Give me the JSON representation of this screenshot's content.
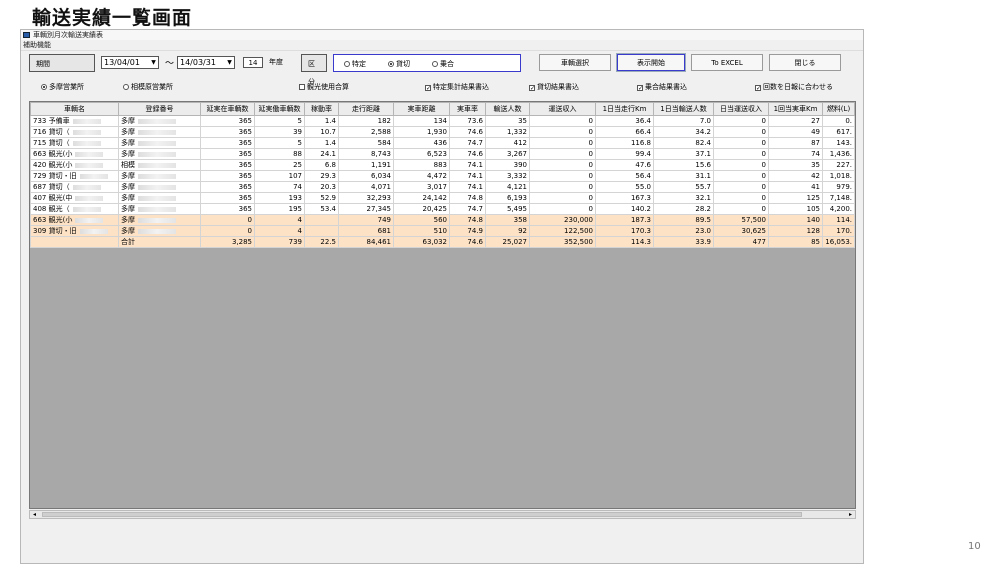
{
  "slide": {
    "title": "輸送実績一覧画面",
    "page_number": "10"
  },
  "window": {
    "title": "車輌別月次輸送実績表",
    "menu": "補助機能"
  },
  "filters": {
    "period_label": "期間",
    "from_date": "13/04/01",
    "wave": "〜",
    "to_date": "14/03/31",
    "year_value": "14",
    "year_label": "年度",
    "class_label": "区分",
    "radios": [
      "特定",
      "貸切",
      "乗合"
    ],
    "selected_radio": "貸切",
    "buttons": {
      "vehicle_select": "車輌選択",
      "start_display": "表示開始",
      "excel": "To EXCEL",
      "close": "閉じる"
    }
  },
  "options": {
    "office_radios": [
      "多摩営業所",
      "相模原営業所"
    ],
    "selected_office": "多摩営業所",
    "checkboxes": [
      {
        "label": "観光使用合算",
        "checked": false
      },
      {
        "label": "特定集計結果書込",
        "checked": true
      },
      {
        "label": "貸切結果書込",
        "checked": true
      },
      {
        "label": "乗合結果書込",
        "checked": true
      },
      {
        "label": "回数を日報に合わせる",
        "checked": true
      }
    ]
  },
  "table": {
    "headers": [
      "車輌名",
      "登録番号",
      "延実在車輌数",
      "延実働車輌数",
      "稼動率",
      "走行距離",
      "実車距離",
      "実車率",
      "輸送人数",
      "運送収入",
      "1日当走行Km",
      "1日当輸送人数",
      "日当運送収入",
      "1回当実車Km",
      "燃料(L)"
    ],
    "rows": [
      {
        "cells": [
          "733 予備車",
          "多摩",
          "365",
          "5",
          "1.4",
          "182",
          "134",
          "73.6",
          "35",
          "0",
          "36.4",
          "7.0",
          "0",
          "27",
          "0."
        ],
        "hl": false
      },
      {
        "cells": [
          "716 貸切（",
          "多摩",
          "365",
          "39",
          "10.7",
          "2,588",
          "1,930",
          "74.6",
          "1,332",
          "0",
          "66.4",
          "34.2",
          "0",
          "49",
          "617."
        ],
        "hl": false
      },
      {
        "cells": [
          "715 貸切（",
          "多摩",
          "365",
          "5",
          "1.4",
          "584",
          "436",
          "74.7",
          "412",
          "0",
          "116.8",
          "82.4",
          "0",
          "87",
          "143."
        ],
        "hl": false
      },
      {
        "cells": [
          "663 観光(小",
          "多摩",
          "365",
          "88",
          "24.1",
          "8,743",
          "6,523",
          "74.6",
          "3,267",
          "0",
          "99.4",
          "37.1",
          "0",
          "74",
          "1,436."
        ],
        "hl": false
      },
      {
        "cells": [
          "420 観光(小",
          "相模",
          "365",
          "25",
          "6.8",
          "1,191",
          "883",
          "74.1",
          "390",
          "0",
          "47.6",
          "15.6",
          "0",
          "35",
          "227."
        ],
        "hl": false
      },
      {
        "cells": [
          "729 貸切・旧",
          "多摩",
          "365",
          "107",
          "29.3",
          "6,034",
          "4,472",
          "74.1",
          "3,332",
          "0",
          "56.4",
          "31.1",
          "0",
          "42",
          "1,018."
        ],
        "hl": false
      },
      {
        "cells": [
          "687 貸切（",
          "多摩",
          "365",
          "74",
          "20.3",
          "4,071",
          "3,017",
          "74.1",
          "4,121",
          "0",
          "55.0",
          "55.7",
          "0",
          "41",
          "979."
        ],
        "hl": false
      },
      {
        "cells": [
          "407 観光(中",
          "多摩",
          "365",
          "193",
          "52.9",
          "32,293",
          "24,142",
          "74.8",
          "6,193",
          "0",
          "167.3",
          "32.1",
          "0",
          "125",
          "7,148."
        ],
        "hl": false
      },
      {
        "cells": [
          "408 観光（",
          "多摩",
          "365",
          "195",
          "53.4",
          "27,345",
          "20,425",
          "74.7",
          "5,495",
          "0",
          "140.2",
          "28.2",
          "0",
          "105",
          "4,200."
        ],
        "hl": false
      },
      {
        "cells": [
          "663 観光(小",
          "多摩",
          "0",
          "4",
          "",
          "749",
          "560",
          "74.8",
          "358",
          "230,000",
          "187.3",
          "89.5",
          "57,500",
          "140",
          "114."
        ],
        "hl": true
      },
      {
        "cells": [
          "309 貸切・旧",
          "多摩",
          "0",
          "4",
          "",
          "681",
          "510",
          "74.9",
          "92",
          "122,500",
          "170.3",
          "23.0",
          "30,625",
          "128",
          "170."
        ],
        "hl": true
      }
    ],
    "total": [
      "",
      "合計",
      "3,285",
      "739",
      "22.5",
      "84,461",
      "63,032",
      "74.6",
      "25,027",
      "352,500",
      "114.3",
      "33.9",
      "477",
      "85",
      "16,053."
    ]
  }
}
